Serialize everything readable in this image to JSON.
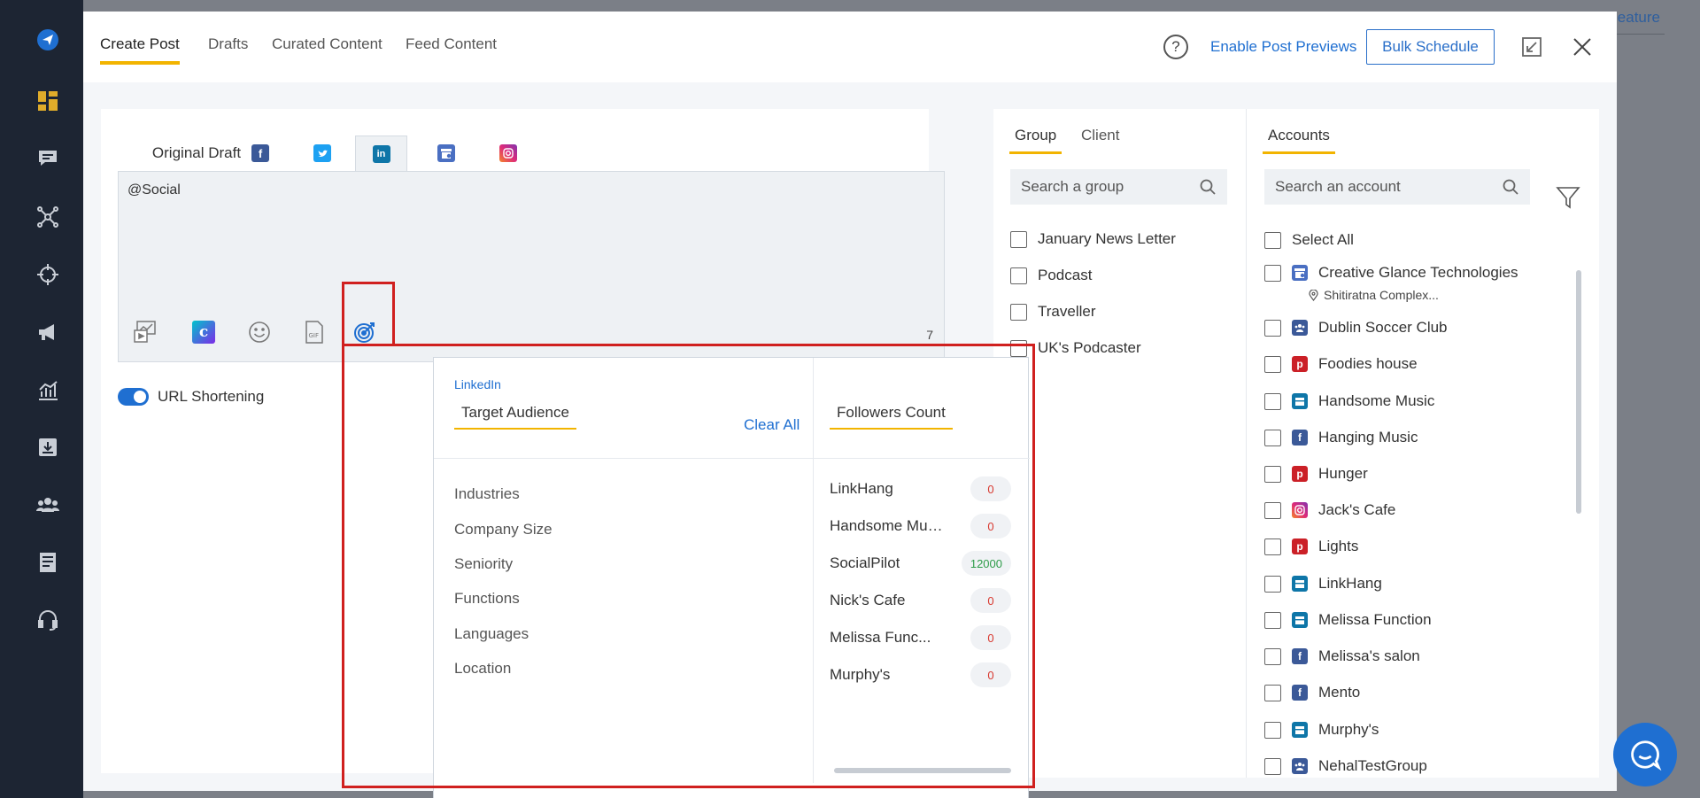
{
  "background": {
    "behind_link": "eature"
  },
  "rail": {
    "icons": [
      "logo-plane-icon",
      "dashboard-icon",
      "chat-icon",
      "network-icon",
      "crosshair-icon",
      "megaphone-icon",
      "analytics-icon",
      "download-icon",
      "team-icon",
      "document-icon",
      "headset-icon"
    ]
  },
  "header": {
    "tabs": [
      "Create Post",
      "Drafts",
      "Curated Content",
      "Feed Content"
    ],
    "active_tab": "Create Post",
    "help": "?",
    "enable_previews": "Enable Post Previews",
    "bulk_schedule": "Bulk Schedule"
  },
  "editor": {
    "tabs": [
      "Original Draft"
    ],
    "network_tabs": [
      "facebook",
      "twitter",
      "linkedin",
      "google-business",
      "instagram"
    ],
    "active_network": "linkedin",
    "text": "@Social",
    "char_count": "7",
    "url_shortening": "URL Shortening",
    "url_shortening_on": true
  },
  "target_popup": {
    "network": "LinkedIn",
    "title": "Target Audience",
    "clear_all": "Clear All",
    "audience_items": [
      "Industries",
      "Company Size",
      "Seniority",
      "Functions",
      "Languages",
      "Location"
    ],
    "followers_title": "Followers Count",
    "followers": [
      {
        "name": "LinkHang",
        "count": "0"
      },
      {
        "name": "Handsome Mus...",
        "count": "0"
      },
      {
        "name": "SocialPilot",
        "count": "12000"
      },
      {
        "name": "Nick's Cafe",
        "count": "0"
      },
      {
        "name": "Melissa Func...",
        "count": "0"
      },
      {
        "name": "Murphy's",
        "count": "0"
      }
    ]
  },
  "groups": {
    "tabs": [
      "Group",
      "Client"
    ],
    "search_placeholder": "Search a group",
    "items": [
      "January News Letter",
      "Podcast",
      "Traveller",
      "UK's Podcaster"
    ]
  },
  "accounts": {
    "tab": "Accounts",
    "search_placeholder": "Search an account",
    "select_all": "Select All",
    "items": [
      {
        "name": "Creative Glance Technologies",
        "type": "google-business",
        "sub": "Shitiratna Complex..."
      },
      {
        "name": "Dublin Soccer Club",
        "type": "facebook-group"
      },
      {
        "name": "Foodies house",
        "type": "pinterest"
      },
      {
        "name": "Handsome Music",
        "type": "linkedin-page"
      },
      {
        "name": "Hanging Music",
        "type": "facebook"
      },
      {
        "name": "Hunger",
        "type": "pinterest"
      },
      {
        "name": "Jack's Cafe",
        "type": "instagram"
      },
      {
        "name": "Lights",
        "type": "pinterest"
      },
      {
        "name": "LinkHang",
        "type": "linkedin-page"
      },
      {
        "name": "Melissa Function",
        "type": "linkedin-page"
      },
      {
        "name": "Melissa's salon",
        "type": "facebook"
      },
      {
        "name": "Mento",
        "type": "facebook"
      },
      {
        "name": "Murphy's",
        "type": "linkedin-page"
      },
      {
        "name": "NehalTestGroup",
        "type": "facebook-group"
      }
    ]
  },
  "colors": {
    "accent": "#f2b400",
    "primary": "#1f6fd1",
    "rail": "#1d2533",
    "facebook": "#3b5998",
    "twitter": "#1da1f2",
    "linkedin": "#0e76a8",
    "pinterest": "#cb2027",
    "highlight": "#d0201f"
  }
}
